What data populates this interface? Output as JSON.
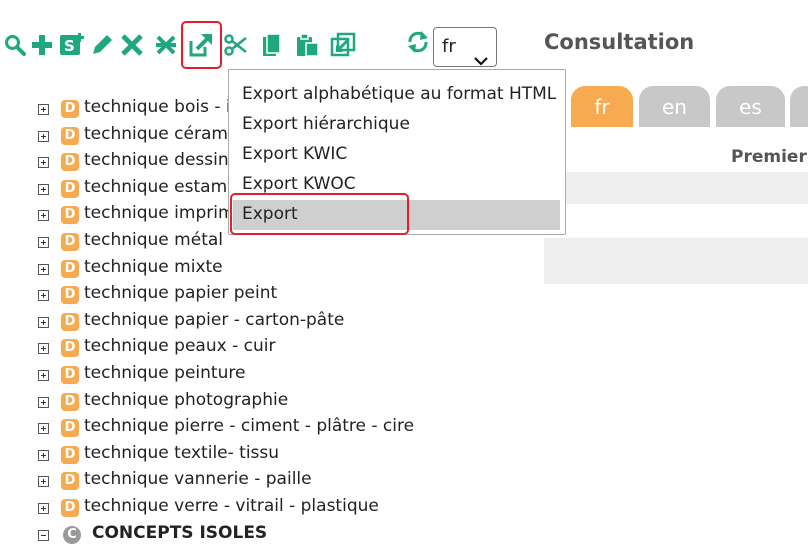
{
  "toolbar": {
    "icons": [
      {
        "name": "search-icon",
        "color": "#1fa87f"
      },
      {
        "name": "add-icon",
        "color": "#1fa87f"
      },
      {
        "name": "synonym-icon",
        "color": "#1fa87f"
      },
      {
        "name": "edit-icon",
        "color": "#1fa87f"
      },
      {
        "name": "delete-icon",
        "color": "#1fa87f"
      },
      {
        "name": "move-icon",
        "color": "#1fa87f"
      },
      {
        "name": "export-icon",
        "color": "#1fa87f"
      },
      {
        "name": "cut-icon",
        "color": "#1fa87f"
      },
      {
        "name": "copy-icon",
        "color": "#1fa87f"
      },
      {
        "name": "paste-icon",
        "color": "#1fa87f"
      },
      {
        "name": "import-icon",
        "color": "#1fa87f"
      },
      {
        "name": "refresh-icon",
        "color": "#1fa87f"
      }
    ],
    "language_select": {
      "value": "fr"
    }
  },
  "heading": "Consultation",
  "tabs": [
    "fr",
    "en",
    "es"
  ],
  "column_header": "Premier",
  "export_menu": {
    "items": [
      "Export alphabétique au format HTML",
      "Export hiérarchique",
      "Export KWIC",
      "Export KWOC",
      "Export"
    ],
    "selected_index": 4
  },
  "tree": {
    "badge": "D",
    "items": [
      "technique bois - ivoire",
      "technique céramique",
      "technique dessin",
      "technique estampe",
      "technique imprimerie",
      "technique métal",
      "technique mixte",
      "technique papier peint",
      "technique papier - carton-pâte",
      "technique peaux - cuir",
      "technique peinture",
      "technique photographie",
      "technique pierre - ciment - plâtre - cire",
      "technique textile- tissu",
      "technique vannerie - paille",
      "technique verre - vitrail - plastique"
    ],
    "last_group": {
      "badge": "C",
      "label": "CONCEPTS ISOLES"
    }
  },
  "colors": {
    "accent": "#f7aa50",
    "icon": "#1fa87f",
    "highlight": "#e3202d"
  }
}
